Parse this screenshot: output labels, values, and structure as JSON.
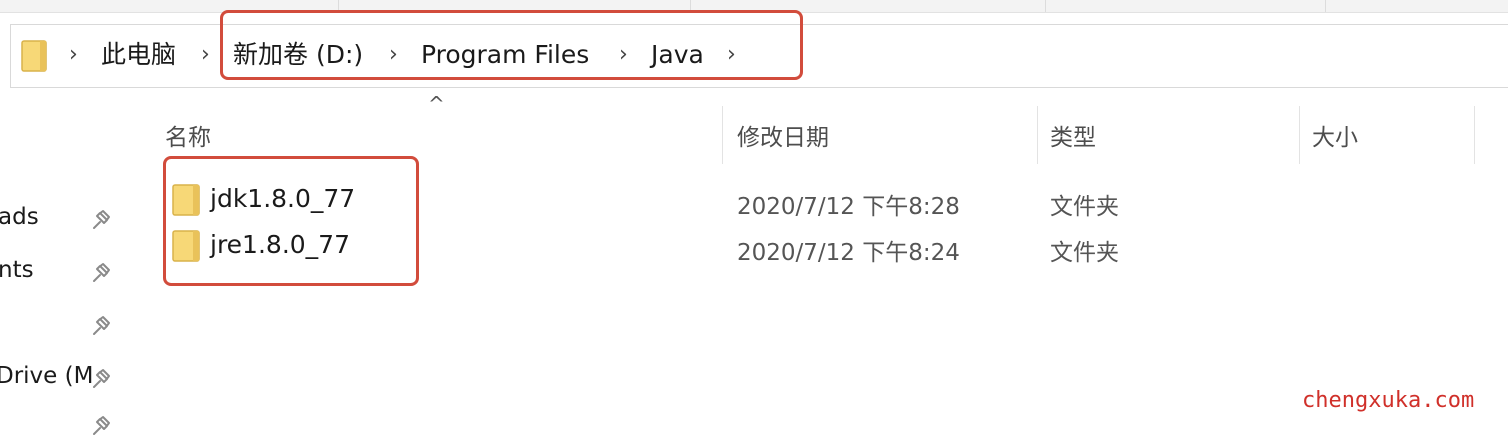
{
  "breadcrumb": {
    "items": [
      {
        "label": "此电脑"
      },
      {
        "label": "新加卷 (D:)"
      },
      {
        "label": "Program Files"
      },
      {
        "label": "Java"
      }
    ]
  },
  "columns": {
    "name": "名称",
    "modified": "修改日期",
    "type": "类型",
    "size": "大小"
  },
  "nav": {
    "items": [
      {
        "label": "ads"
      },
      {
        "label": "nts"
      },
      {
        "label": ""
      },
      {
        "label": "Drive (M"
      },
      {
        "label": ""
      }
    ]
  },
  "files": [
    {
      "name": "jdk1.8.0_77",
      "modified": "2020/7/12 下午8:28",
      "type": "文件夹",
      "size": ""
    },
    {
      "name": "jre1.8.0_77",
      "modified": "2020/7/12 下午8:24",
      "type": "文件夹",
      "size": ""
    }
  ],
  "watermark": "chengxuka.com",
  "colors": {
    "folder": "#f7d877",
    "highlight": "#d24c3c",
    "watermark": "#d0302a"
  },
  "icons": {
    "folder": "folder-icon",
    "chevron": "chevron-right-icon",
    "pin": "pin-icon",
    "sort": "sort-ascending-icon"
  }
}
